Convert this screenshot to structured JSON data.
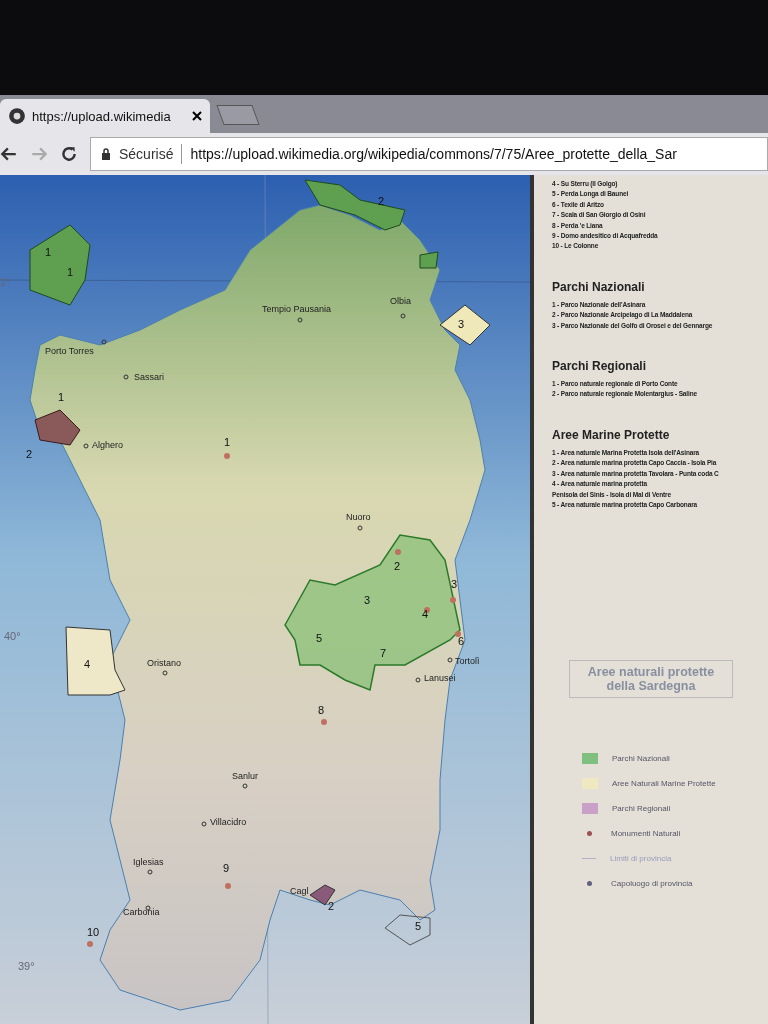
{
  "browser": {
    "tab_title": "https://upload.wikimedia",
    "secure_label": "Sécurisé",
    "url": "https://upload.wikimedia.org/wikipedia/commons/7/75/Aree_protette_della_Sar"
  },
  "map": {
    "degree_labels": [
      "1°",
      "40°",
      "39°"
    ],
    "towns": [
      "Tempio Pausania",
      "Olbia",
      "Porto Torres",
      "Sassari",
      "Alghero",
      "Nuoro",
      "Oristano",
      "Tortolì",
      "Lanusei",
      "Sanlur",
      "Villacidro",
      "Iglesias",
      "Cagl",
      "Carbonia"
    ],
    "numbers": [
      "1",
      "1",
      "2",
      "3",
      "1",
      "2",
      "1",
      "2",
      "3",
      "3",
      "4",
      "6",
      "5",
      "7",
      "4",
      "8",
      "9",
      "2",
      "5",
      "10"
    ]
  },
  "legend": {
    "monuments": [
      "4 - Su Sterru (Il Golgo)",
      "5 - Perda Longa di Baunei",
      "6 - Texile di Aritzo",
      "7 - Scala di San Giorgio di Osini",
      "8 - Perda 'e Liana",
      "9 - Domo andesitico di Acquafredda",
      "10 - Le Colonne"
    ],
    "sections": [
      {
        "heading": "Parchi Nazionali",
        "items": [
          "1 - Parco Nazionale dell'Asinara",
          "2 - Parco Nazionale Arcipelago di La Maddalena",
          "3 - Parco Nazionale del Golfo di Orosei e del Gennarge"
        ]
      },
      {
        "heading": "Parchi Regionali",
        "items": [
          "1 - Parco naturale regionale di Porto Conte",
          "2 - Parco naturale regionale Molentargius - Saline"
        ]
      },
      {
        "heading": "Aree Marine Protette",
        "items": [
          "1 - Area naturale Marina Protetta Isola dell'Asinara",
          "2 - Area naturale marina protetta Capo Caccia - Isola Pia",
          "3 - Area naturale marina protetta Tavolara - Punta coda C",
          "4 - Area naturale marina protetta",
          "Penisola del Sinis - Isola di Mal di Ventre",
          "5 - Area naturale marina protetta Capo Carbonara"
        ]
      }
    ],
    "title": "Aree naturali protette della Sardegna",
    "key": [
      {
        "kind": "swatch",
        "label": "Parchi Nazionali",
        "color": "#7fbf7f"
      },
      {
        "kind": "swatch",
        "label": "Aree Naturali Marine Protette",
        "color": "#efe8c0"
      },
      {
        "kind": "swatch",
        "label": "Parchi Regionali",
        "color": "#c8a0c8"
      },
      {
        "kind": "dot",
        "label": "Monumenti Naturali",
        "color": "#a05050"
      },
      {
        "kind": "line",
        "label": "Limiti di provincia",
        "color": "#b0b0c8"
      },
      {
        "kind": "town",
        "label": "Capoluogo di provincia",
        "color": "#606080"
      }
    ]
  }
}
